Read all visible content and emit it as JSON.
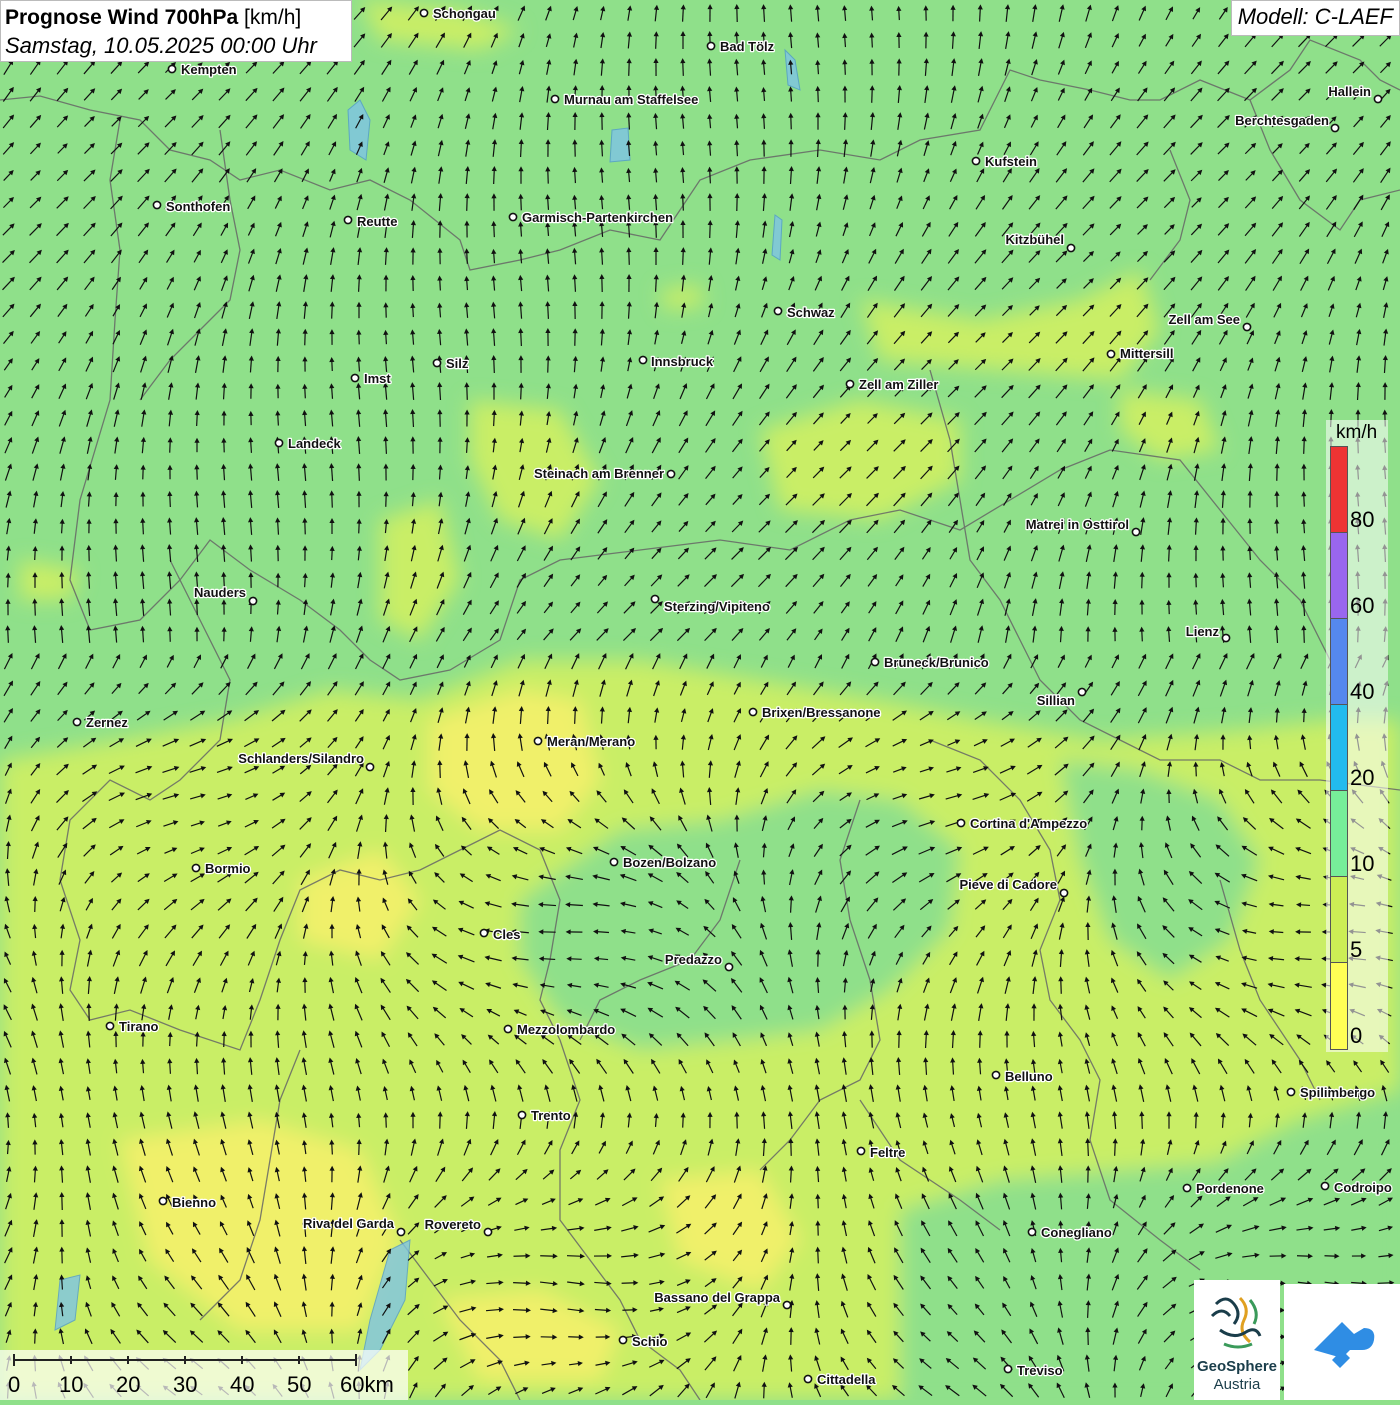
{
  "header": {
    "title_bold": "Prognose Wind 700hPa",
    "title_unit": "[km/h]",
    "datetime": "Samstag, 10.05.2025 00:00 Uhr",
    "model": "Modell: C-LAEF"
  },
  "legend": {
    "unit": "km/h",
    "labels": [
      "80",
      "60",
      "40",
      "20",
      "10",
      "5",
      "0"
    ],
    "colors": [
      "#ee3333",
      "#9966ee",
      "#5588ee",
      "#22bbee",
      "#77ee99",
      "#ccee55",
      "#ffff55"
    ]
  },
  "scale": {
    "labels": [
      "0",
      "10",
      "20",
      "30",
      "40",
      "50",
      "60km"
    ]
  },
  "logo": {
    "name": "GeoSphere",
    "country": "Austria"
  },
  "colors": {
    "wind_low": "#f0f06a",
    "wind_mid": "#c9ee66",
    "wind_high": "#8fe08a",
    "border": "#666666",
    "arrow": "#111111"
  },
  "cities": [
    {
      "name": "Schongau"
    },
    {
      "name": "Bad Tölz"
    },
    {
      "name": "Kempten"
    },
    {
      "name": "Murnau am Staffelsee"
    },
    {
      "name": "Hallein"
    },
    {
      "name": "Berchtesgaden"
    },
    {
      "name": "Kufstein"
    },
    {
      "name": "Sonthofen"
    },
    {
      "name": "Reutte"
    },
    {
      "name": "Garmisch-Partenkirchen"
    },
    {
      "name": "Kitzbühel"
    },
    {
      "name": "Schwaz"
    },
    {
      "name": "Zell am See"
    },
    {
      "name": "Innsbruck"
    },
    {
      "name": "Mittersill"
    },
    {
      "name": "Silz"
    },
    {
      "name": "Imst"
    },
    {
      "name": "Zell am Ziller"
    },
    {
      "name": "Landeck"
    },
    {
      "name": "Steinach am Brenner"
    },
    {
      "name": "Matrei in Osttirol"
    },
    {
      "name": "Nauders"
    },
    {
      "name": "Sterzing/Vipiteno"
    },
    {
      "name": "Lienz"
    },
    {
      "name": "Bruneck/Brunico"
    },
    {
      "name": "Sillian"
    },
    {
      "name": "Zernez"
    },
    {
      "name": "Brixen/Bressanone"
    },
    {
      "name": "Meran/Merano"
    },
    {
      "name": "Schlanders/Silandro"
    },
    {
      "name": "Cortina d'Ampezzo"
    },
    {
      "name": "Bozen/Bolzano"
    },
    {
      "name": "Bormio"
    },
    {
      "name": "Pieve di Cadore"
    },
    {
      "name": "Cles"
    },
    {
      "name": "Predazzo"
    },
    {
      "name": "Tirano"
    },
    {
      "name": "Mezzolombardo"
    },
    {
      "name": "Belluno"
    },
    {
      "name": "Spilimbergo"
    },
    {
      "name": "Trento"
    },
    {
      "name": "Feltre"
    },
    {
      "name": "Pordenone"
    },
    {
      "name": "Codroipo"
    },
    {
      "name": "Bienno"
    },
    {
      "name": "Riva del Garda"
    },
    {
      "name": "Rovereto"
    },
    {
      "name": "Conegliano"
    },
    {
      "name": "Bassano del Grappa"
    },
    {
      "name": "Schio"
    },
    {
      "name": "Treviso"
    },
    {
      "name": "Cittadella"
    }
  ]
}
